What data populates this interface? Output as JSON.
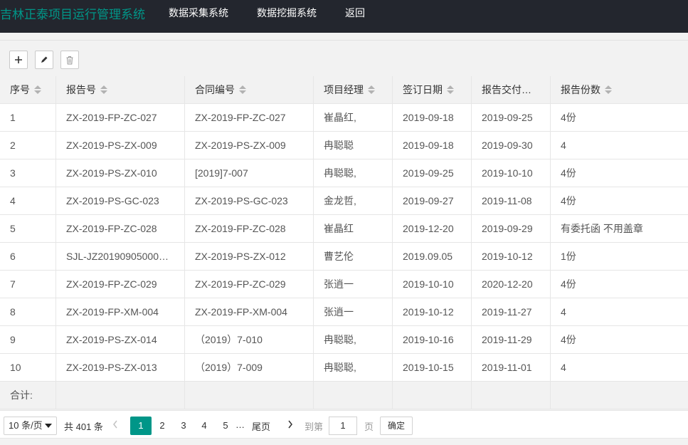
{
  "header": {
    "brand": "吉林正泰项目运行管理系统",
    "nav": [
      "数据采集系统",
      "数据挖掘系统",
      "返回"
    ]
  },
  "toolbar": {
    "add_icon": "plus-icon",
    "edit_icon": "pencil-icon",
    "delete_icon": "trash-icon"
  },
  "table": {
    "columns": [
      "序号",
      "报告号",
      "合同编号",
      "项目经理",
      "签订日期",
      "报告交付…",
      "报告份数"
    ],
    "rows": [
      [
        "1",
        "ZX-2019-FP-ZC-027",
        "ZX-2019-FP-ZC-027",
        "崔晶红,",
        "2019-09-18",
        "2019-09-25",
        "4份"
      ],
      [
        "2",
        "ZX-2019-PS-ZX-009",
        "ZX-2019-PS-ZX-009",
        "冉聪聪",
        "2019-09-18",
        "2019-09-30",
        "4"
      ],
      [
        "3",
        "ZX-2019-PS-ZX-010",
        "[2019]7-007",
        "冉聪聪,",
        "2019-09-25",
        "2019-10-10",
        "4份"
      ],
      [
        "4",
        "ZX-2019-PS-GC-023",
        "ZX-2019-PS-GC-023",
        "金龙哲,",
        "2019-09-27",
        "2019-11-08",
        "4份"
      ],
      [
        "5",
        "ZX-2019-FP-ZC-028",
        "ZX-2019-FP-ZC-028",
        "崔晶红",
        "2019-12-20",
        "2019-09-29",
        "有委托函 不用盖章"
      ],
      [
        "6",
        "SJL-JZ20190905000…",
        "ZX-2019-PS-ZX-012",
        "曹艺伦",
        "2019.09.05",
        "2019-10-12",
        "1份"
      ],
      [
        "7",
        "ZX-2019-FP-ZC-029",
        "ZX-2019-FP-ZC-029",
        "张逍一",
        "2019-10-10",
        "2020-12-20",
        "4份"
      ],
      [
        "8",
        "ZX-2019-FP-XM-004",
        "ZX-2019-FP-XM-004",
        "张逍一",
        "2019-10-12",
        "2019-11-27",
        "4"
      ],
      [
        "9",
        "ZX-2019-PS-ZX-014",
        "（2019）7-010",
        "冉聪聪,",
        "2019-10-16",
        "2019-11-29",
        "4份"
      ],
      [
        "10",
        "ZX-2019-PS-ZX-013",
        "（2019）7-009",
        "冉聪聪,",
        "2019-10-15",
        "2019-11-01",
        "4"
      ]
    ],
    "total_label": "合计:"
  },
  "pagination": {
    "page_size": "10 条/页",
    "total": "共 401 条",
    "prev_icon": "chevron-left-icon",
    "pages": [
      "1",
      "2",
      "3",
      "4",
      "5"
    ],
    "current_page": "1",
    "ellipsis": "…",
    "last": "尾页",
    "next_icon": "chevron-right-icon",
    "goto_label": "到第",
    "goto_value": "1",
    "page_unit": "页",
    "confirm": "确定"
  },
  "colors": {
    "accent": "#009688",
    "header_bg": "#23262e"
  }
}
